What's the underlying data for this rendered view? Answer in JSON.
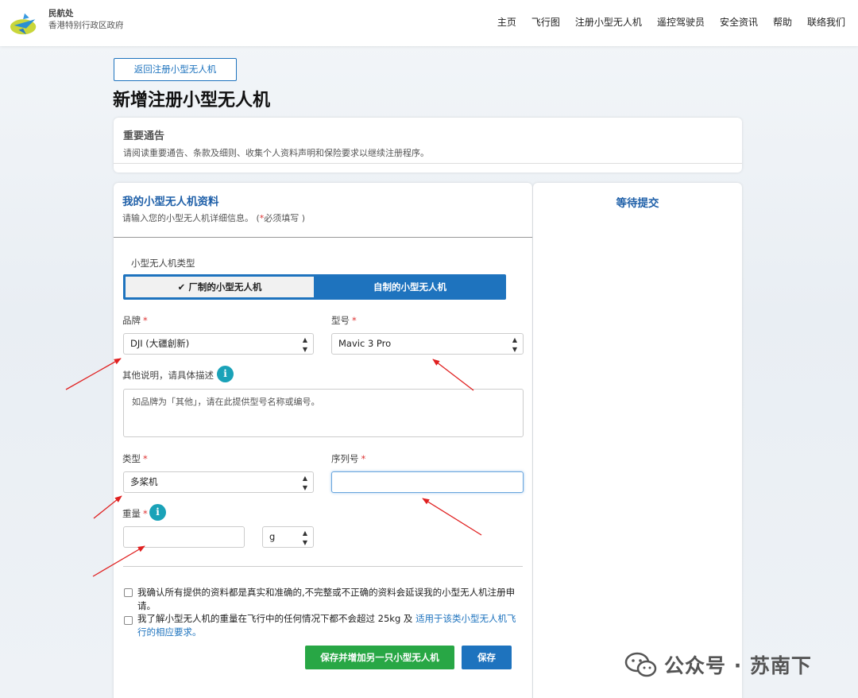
{
  "header": {
    "org_name": "民航处",
    "org_sub": "香港特别行政区政府",
    "nav": [
      "主页",
      "飞行图",
      "注册小型无人机",
      "遥控驾驶员",
      "安全资讯",
      "帮助",
      "联络我们"
    ]
  },
  "back_button": "返回注册小型无人机",
  "page_title": "新增注册小型无人机",
  "notice": {
    "title": "重要通告",
    "text": "请阅读重要通告、条款及细则、收集个人资料声明和保险要求以继续注册程序。"
  },
  "form": {
    "title": "我的小型无人机资料",
    "subtitle_prefix": "请输入您的小型无人机详细信息。 (",
    "subtitle_star": "*",
    "subtitle_suffix": "必须填写 )",
    "drone_type_label": "小型无人机类型",
    "toggle_left": "厂制的小型无人机",
    "toggle_right": "自制的小型无人机",
    "brand_label": "品牌",
    "brand_value": "DJI (大疆創新)",
    "model_label": "型号",
    "model_value": "Mavic 3 Pro",
    "other_label": "其他说明，请具体描述",
    "other_placeholder": "如品牌为「其他」，请在此提供型号名称或编号。",
    "category_label": "类型",
    "category_value": "多桨机",
    "serial_label": "序列号",
    "serial_value": "",
    "weight_label": "重量",
    "weight_value": "",
    "weight_unit": "g",
    "required_star": "*",
    "info_glyph": "i",
    "confirm1": "我确认所有提供的资料都是真实和准确的,不完整或不正确的资料会延误我的小型无人机注册申请。",
    "confirm2_prefix": "我了解小型无人机的重量在飞行中的任何情况下都不会超过 25kg 及 ",
    "confirm2_link": "适用于该类小型无人机飞行的相应要求。",
    "save_add_button": "保存并增加另一只小型无人机",
    "save_button": "保存"
  },
  "side": {
    "title": "等待提交"
  },
  "watermark": "公众号 · 苏南下",
  "colors": {
    "primary": "#1e73be",
    "success": "#28a745",
    "required": "#d33333",
    "info": "#1aa2b8",
    "annotation_arrow": "#e02020"
  },
  "icons": {
    "logo": "cad-logo-icon",
    "check": "check-icon",
    "info": "info-icon",
    "select_arrows": "sort-arrows-icon",
    "watermark": "wechat-icon"
  }
}
